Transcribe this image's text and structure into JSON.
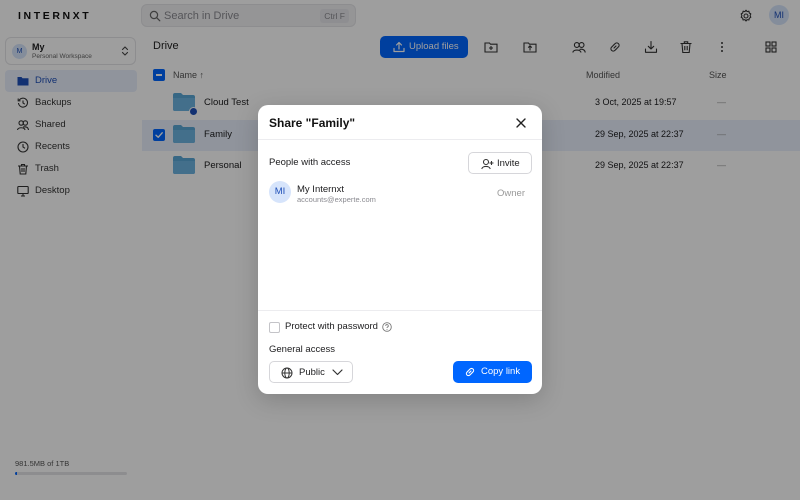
{
  "app": {
    "logo": "INTERNXT",
    "search_placeholder": "Search in Drive",
    "search_shortcut": "Ctrl F",
    "user_initials": "MI"
  },
  "sidebar": {
    "workspace_name": "My",
    "workspace_sub": "Personal Workspace",
    "workspace_initials": "M",
    "items": [
      {
        "label": "Drive",
        "icon": "folder-icon",
        "active": true
      },
      {
        "label": "Backups",
        "icon": "history-icon",
        "active": false
      },
      {
        "label": "Shared",
        "icon": "users-icon",
        "active": false
      },
      {
        "label": "Recents",
        "icon": "clock-icon",
        "active": false
      },
      {
        "label": "Trash",
        "icon": "trash-icon",
        "active": false
      },
      {
        "label": "Desktop",
        "icon": "desktop-icon",
        "active": false
      }
    ],
    "storage_text": "981.5MB of 1TB",
    "storage_fraction": 0.001
  },
  "main": {
    "breadcrumb": "Drive",
    "upload_label": "Upload files",
    "columns": {
      "name": "Name",
      "modified": "Modified",
      "size": "Size"
    },
    "rows": [
      {
        "name": "Cloud Test",
        "modified": "3 Oct, 2025 at 19:57",
        "size": "—",
        "shared": true,
        "selected": false
      },
      {
        "name": "Family",
        "modified": "29 Sep, 2025 at 22:37",
        "size": "—",
        "shared": false,
        "selected": true
      },
      {
        "name": "Personal",
        "modified": "29 Sep, 2025 at 22:37",
        "size": "—",
        "shared": false,
        "selected": false
      }
    ]
  },
  "modal": {
    "title": "Share \"Family\"",
    "people_label": "People with access",
    "invite_label": "Invite",
    "user": {
      "initials": "MI",
      "name": "My Internxt",
      "email": "accounts@experte.com",
      "role": "Owner"
    },
    "password_label": "Protect with password",
    "general_access_label": "General access",
    "access_value": "Public",
    "copy_link_label": "Copy link"
  },
  "colors": {
    "accent": "#0066ff",
    "folder": "#5aa6d6",
    "selected_row": "#e8effc"
  }
}
